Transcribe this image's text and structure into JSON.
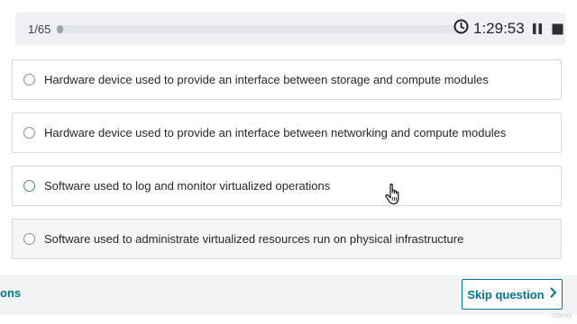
{
  "header": {
    "counter": "1/65",
    "progress_fraction": 0.015,
    "timer": "1:29:53",
    "icons": {
      "timer": "clock-icon",
      "pause": "pause-icon",
      "stop": "stop-icon"
    }
  },
  "options": [
    {
      "label": "Hardware device used to provide an interface between storage and compute modules"
    },
    {
      "label": "Hardware device used to provide an interface between networking and compute modules"
    },
    {
      "label": "Software used to log and monitor virtualized operations"
    },
    {
      "label": "Software used to administrate virtualized resources run on physical infrastructure"
    }
  ],
  "footer": {
    "prev_link": "ons",
    "skip_label": "Skip question",
    "skip_icon": "chevron-right-icon"
  },
  "watermark": "Udemy",
  "colors": {
    "accent": "#007791",
    "bar_bg": "#eef0f3",
    "footer_bg": "#f2f3f5",
    "border": "#d5d9de"
  }
}
